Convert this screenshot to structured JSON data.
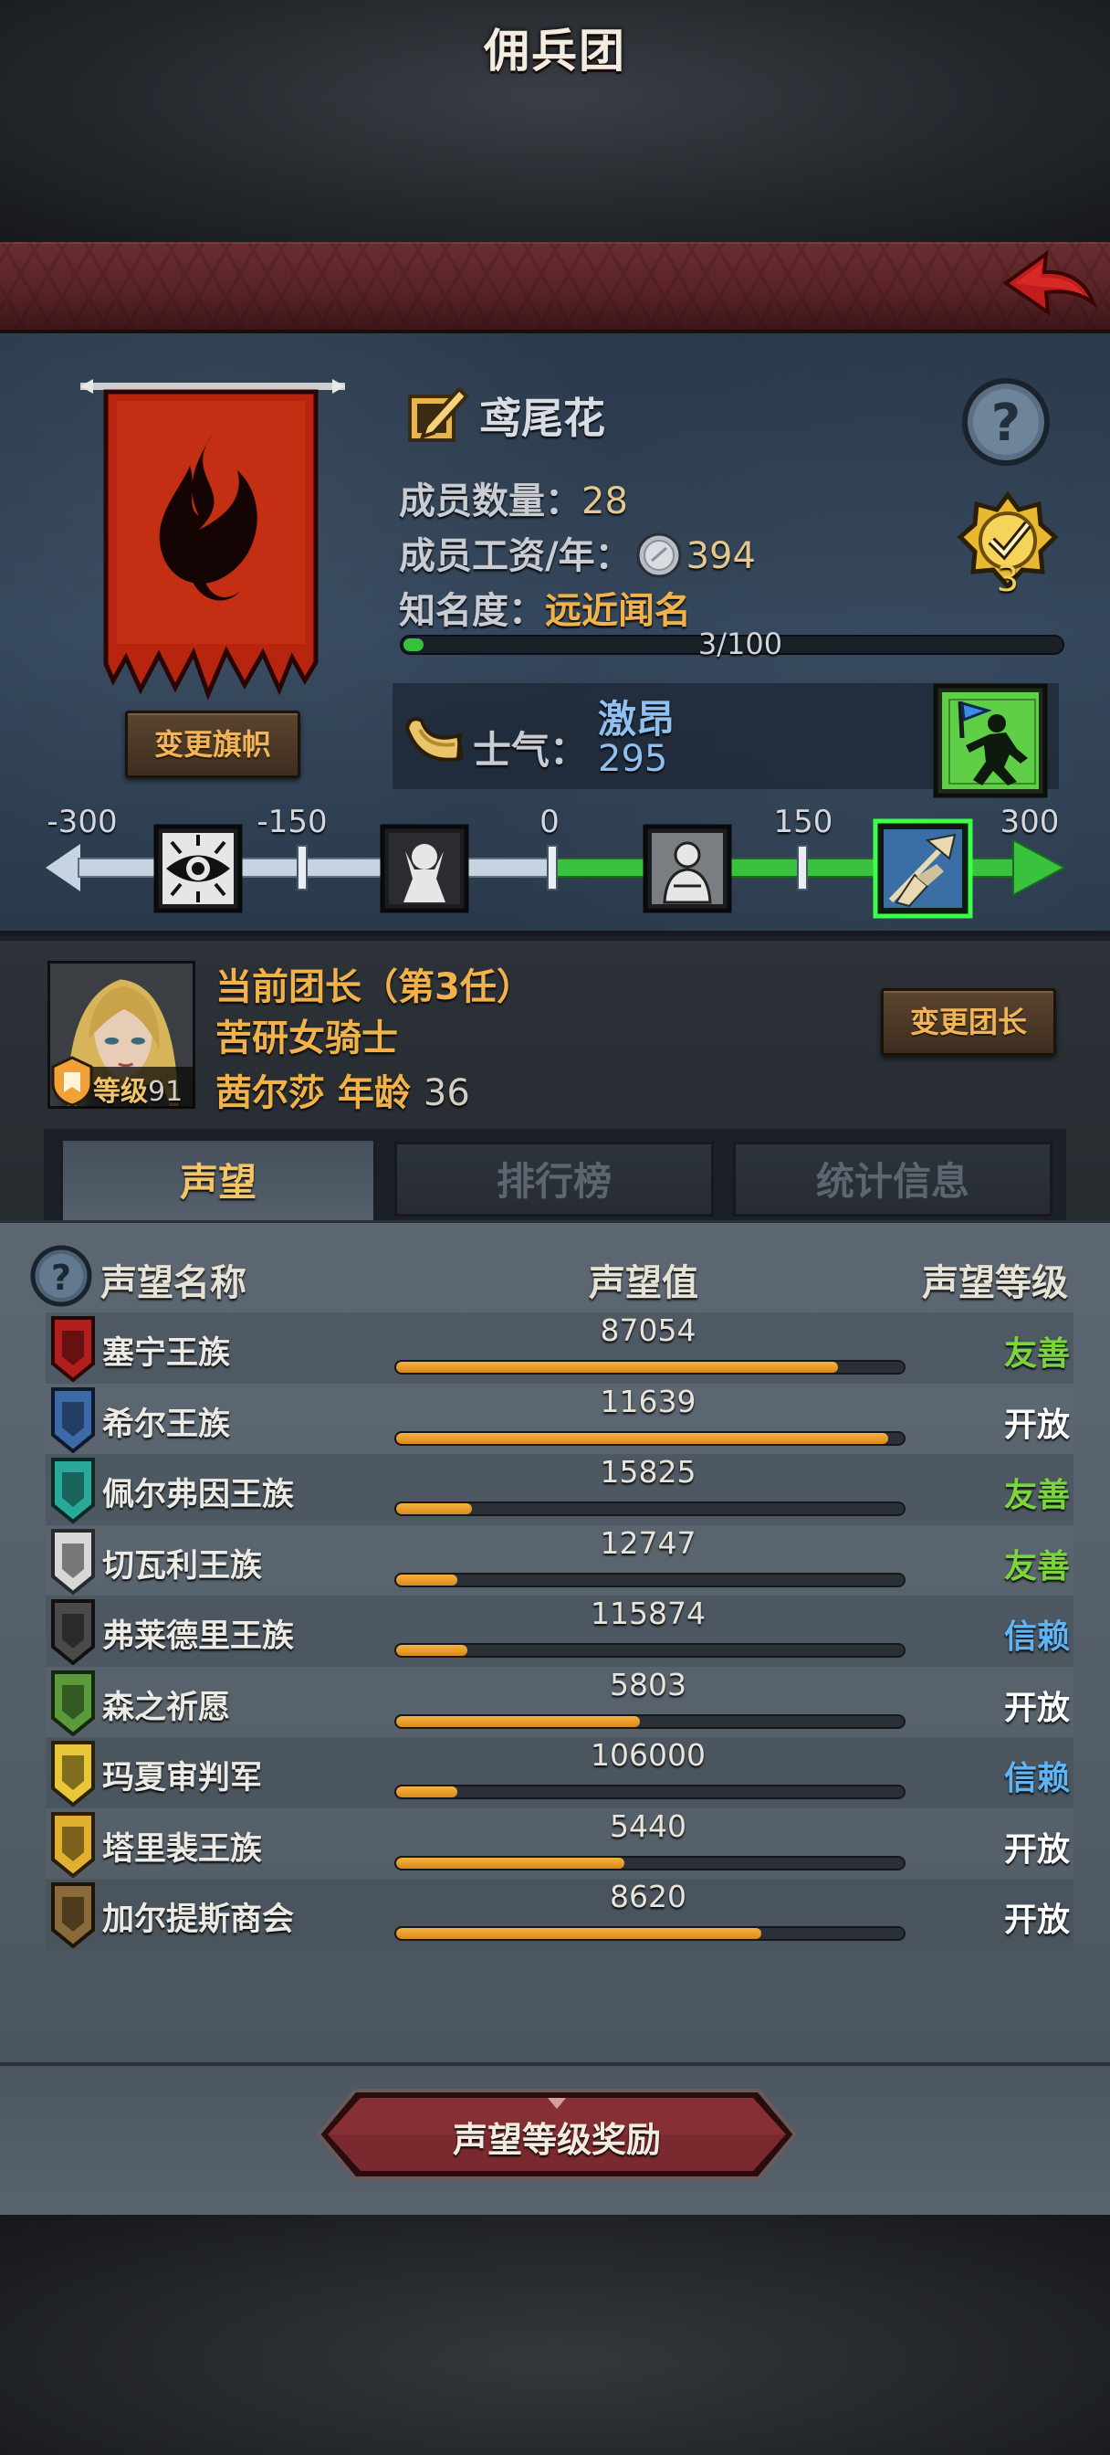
{
  "title": "佣兵团",
  "clan": {
    "name": "鸢尾花",
    "members_label": "成员数量：",
    "members_value": "28",
    "wage_label": "成员工资/年：",
    "wage_value": "394",
    "fame_label": "知名度：",
    "fame_value": "远近闻名",
    "fame_progress_text": "3/100",
    "fame_progress_fraction": 0.03,
    "medal_count": "3",
    "change_flag_label": "变更旗帜"
  },
  "morale": {
    "label": "士气：",
    "state": "激昂",
    "value": "295",
    "scale_min": -300,
    "scale_max": 300,
    "current": 295,
    "ticks": [
      "-300",
      "-150",
      "0",
      "150",
      "300"
    ]
  },
  "leader": {
    "title": "当前团长（第3任）",
    "class": "苦研女骑士",
    "name_age": "茜尔莎  年龄",
    "age": "36",
    "level_label": "等级",
    "level": "91",
    "change_label": "变更团长"
  },
  "tabs": [
    {
      "label": "声望"
    },
    {
      "label": "排行榜"
    },
    {
      "label": "统计信息"
    }
  ],
  "table": {
    "col_name": "声望名称",
    "col_value": "声望值",
    "col_level": "声望等级",
    "rows": [
      {
        "name": "塞宁王族",
        "value": "87054",
        "fill": 0.87,
        "level": "友善",
        "color": "#7bd63e",
        "icon": "crest-red-icon"
      },
      {
        "name": "希尔王族",
        "value": "11639",
        "fill": 0.97,
        "level": "开放",
        "color": "#ffffff",
        "icon": "crest-blue-icon"
      },
      {
        "name": "佩尔弗因王族",
        "value": "15825",
        "fill": 0.15,
        "level": "友善",
        "color": "#7bd63e",
        "icon": "crest-teal-icon"
      },
      {
        "name": "切瓦利王族",
        "value": "12747",
        "fill": 0.12,
        "level": "友善",
        "color": "#7bd63e",
        "icon": "crest-white-icon"
      },
      {
        "name": "弗莱德里王族",
        "value": "115874",
        "fill": 0.14,
        "level": "信赖",
        "color": "#5fb4f4",
        "icon": "crest-dark-icon"
      },
      {
        "name": "森之祈愿",
        "value": "5803",
        "fill": 0.48,
        "level": "开放",
        "color": "#ffffff",
        "icon": "crest-green-icon"
      },
      {
        "name": "玛夏审判军",
        "value": "106000",
        "fill": 0.12,
        "level": "信赖",
        "color": "#5fb4f4",
        "icon": "crest-yellow-icon"
      },
      {
        "name": "塔里裴王族",
        "value": "5440",
        "fill": 0.45,
        "level": "开放",
        "color": "#ffffff",
        "icon": "crest-gold-icon"
      },
      {
        "name": "加尔提斯商会",
        "value": "8620",
        "fill": 0.72,
        "level": "开放",
        "color": "#ffffff",
        "icon": "crest-chest-icon"
      }
    ]
  },
  "reward_button": "声望等级奖励"
}
